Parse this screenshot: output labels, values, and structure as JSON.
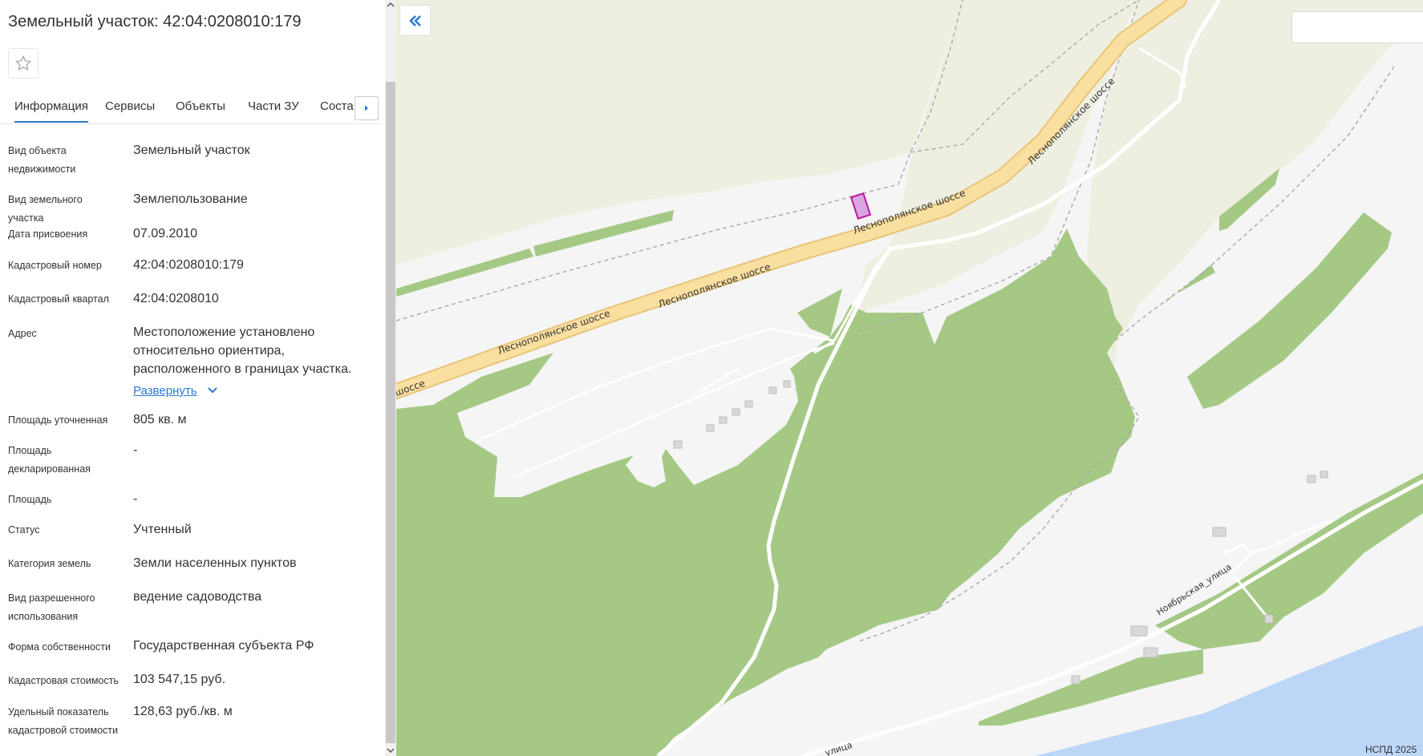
{
  "panel": {
    "title": "Земельный участок: 42:04:0208010:179",
    "tabs": [
      "Информация",
      "Сервисы",
      "Объекты",
      "Части ЗУ",
      "Состав"
    ],
    "rows": [
      {
        "label": "Вид объекта недвижимости",
        "value": "Земельный участок"
      },
      {
        "label": "Вид земельного участка",
        "value": "Землепользование"
      },
      {
        "label": "Дата присвоения",
        "value": "07.09.2010"
      },
      {
        "label": "Кадастровый номер",
        "value": "42:04:0208010:179"
      },
      {
        "label": "Кадастровый квартал",
        "value": "42:04:0208010"
      },
      {
        "label": "Адрес",
        "value": "Местоположение установлено относительно ориентира, расположенного в границах участка."
      },
      {
        "label": "Площадь уточненная",
        "value": "805 кв. м"
      },
      {
        "label": "Площадь декларированная",
        "value": "-"
      },
      {
        "label": "Площадь",
        "value": "-"
      },
      {
        "label": "Статус",
        "value": "Учтенный"
      },
      {
        "label": "Категория земель",
        "value": "Земли населенных пунктов"
      },
      {
        "label": "Вид разрешенного использования",
        "value": "ведение садоводства"
      },
      {
        "label": "Форма собственности",
        "value": "Государственная субъекта РФ"
      },
      {
        "label": "Кадастровая стоимость",
        "value": "103 547,15 руб."
      },
      {
        "label": "Удельный показатель кадастровой стоимости",
        "value": "128,63 руб./кв. м"
      }
    ],
    "expand_label": "Развернуть"
  },
  "map": {
    "roads": {
      "highway": "Леснополянское шоссе",
      "highway_tail": "шоссе",
      "street": "Ноябрьская_улица",
      "street_bottom": "улица"
    },
    "copyright": "НСПД 2025",
    "colors": {
      "forest": "#a5c985",
      "field": "#efefe1",
      "river": "#bcd6f7",
      "highway": "#f9dfa0",
      "parcel": "#c0159a"
    }
  }
}
